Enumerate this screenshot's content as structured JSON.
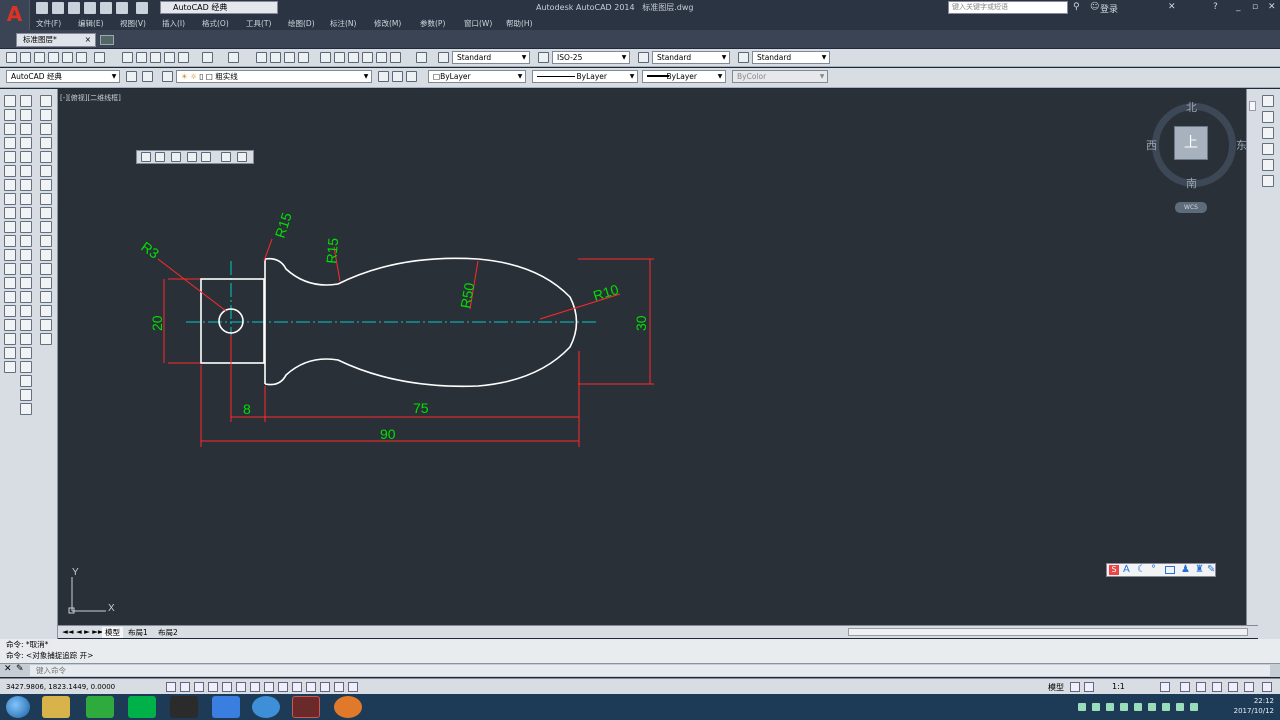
{
  "app": {
    "title": "Autodesk AutoCAD 2014",
    "filename": "标准图层.dwg",
    "workspace": "AutoCAD 经典",
    "search_placeholder": "键入关键字或短语",
    "login": "登录",
    "logo_letter": "A"
  },
  "menu": [
    "文件(F)",
    "编辑(E)",
    "视图(V)",
    "插入(I)",
    "格式(O)",
    "工具(T)",
    "绘图(D)",
    "标注(N)",
    "修改(M)",
    "参数(P)",
    "窗口(W)",
    "帮助(H)"
  ],
  "file_tab": {
    "label": "标准图层*",
    "close": "×"
  },
  "styles": {
    "text_style": "Standard",
    "dim_style": "ISO-25",
    "table_style": "Standard",
    "mleader_style": "Standard"
  },
  "properties": {
    "workspace": "AutoCAD 经典",
    "layer": "粗实线",
    "color": "ByLayer",
    "linetype": "ByLayer",
    "lineweight": "ByLayer",
    "plotstyle": "ByColor"
  },
  "viewport_label": "[-][俯视][二维线框]",
  "viewcube": {
    "north": "北",
    "south": "南",
    "east": "东",
    "west": "西",
    "top": "上",
    "wcs": "WCS"
  },
  "ucs": {
    "x": "X",
    "y": "Y"
  },
  "dimensions": {
    "r3": "R3",
    "r15_a": "R15",
    "r15_b": "R15",
    "r50": "R50",
    "r10": "R10",
    "d20": "20",
    "d30": "30",
    "d8": "8",
    "d75": "75",
    "d90": "90"
  },
  "layout_tabs": [
    "模型",
    "布局1",
    "布局2"
  ],
  "command_history": [
    "命令: *取消*",
    "命令: <对象捕捉追踪 开>"
  ],
  "command_prompt": "键入命令",
  "coordinates": "3427.9806, 1823.1449, 0.0000",
  "status": {
    "model": "模型",
    "scale": "1:1"
  },
  "clock": {
    "time": "22:12",
    "date": "2017/10/12"
  },
  "colors": {
    "canvas": "#2a3038",
    "dimension": "#ff2a2a",
    "dim_text": "#00e000",
    "centerline": "#00c8c8",
    "geometry": "#ffffff"
  }
}
